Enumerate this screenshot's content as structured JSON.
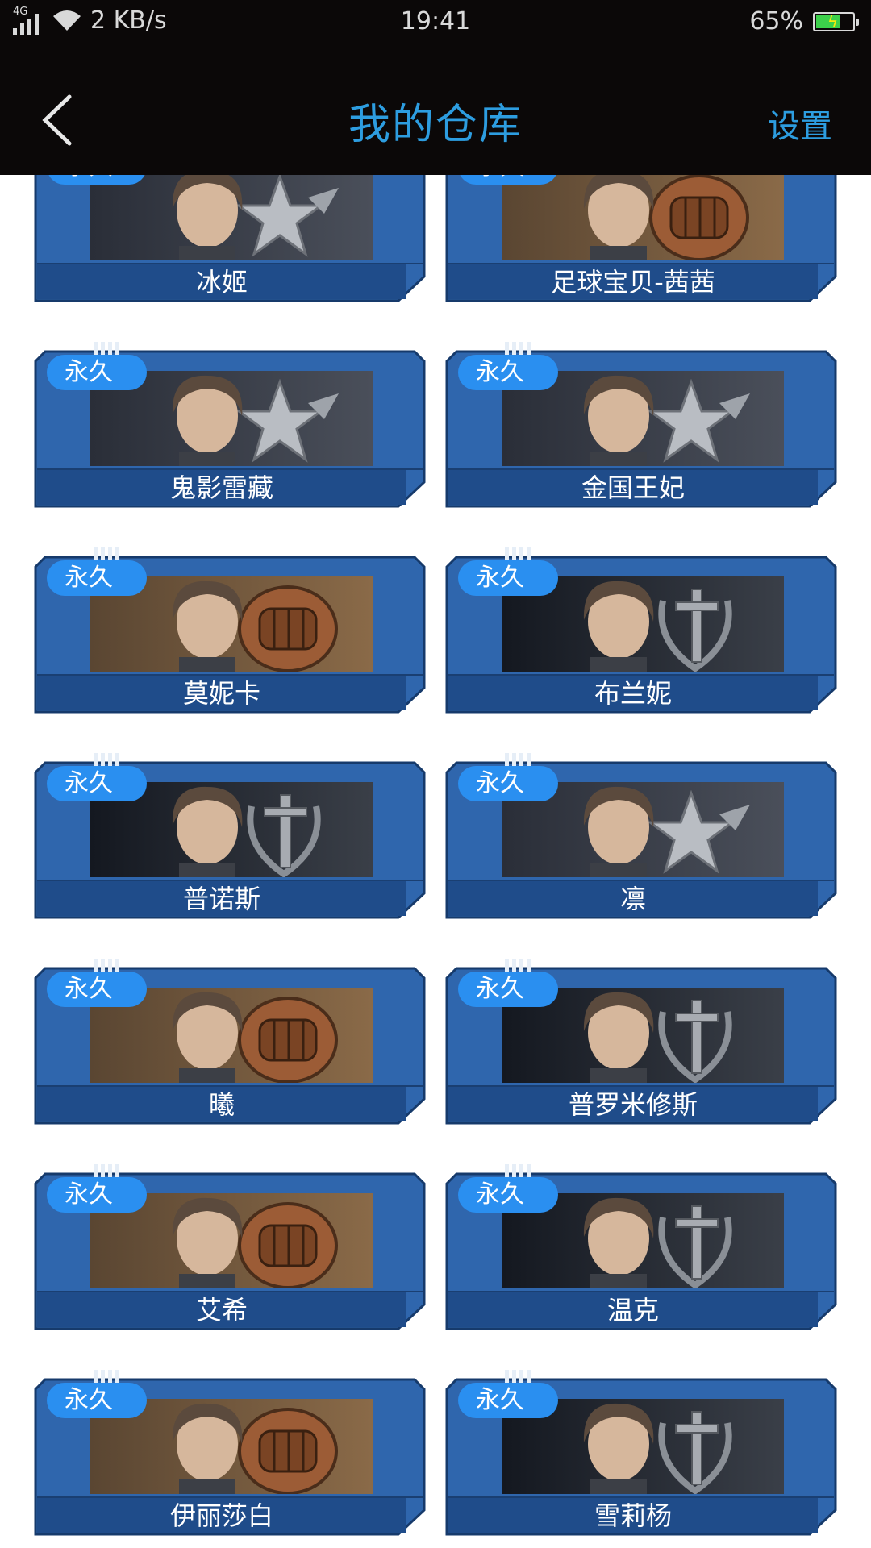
{
  "status_bar": {
    "network_type": "4G",
    "speed": "2 KB/s",
    "time": "19:41",
    "battery": "65%",
    "battery_level": 0.65
  },
  "nav": {
    "back_icon": "chevron-left-icon",
    "title": "我的仓库",
    "settings_label": "设置"
  },
  "items": [
    {
      "name": "冰姬",
      "badge": "永久",
      "emblem": "star"
    },
    {
      "name": "足球宝贝-茜茜",
      "badge": "永久",
      "emblem": "fist"
    },
    {
      "name": "鬼影雷藏",
      "badge": "永久",
      "emblem": "star"
    },
    {
      "name": "金国王妃",
      "badge": "永久",
      "emblem": "star"
    },
    {
      "name": "莫妮卡",
      "badge": "永久",
      "emblem": "fist"
    },
    {
      "name": "布兰妮",
      "badge": "永久",
      "emblem": "sword"
    },
    {
      "name": "普诺斯",
      "badge": "永久",
      "emblem": "sword"
    },
    {
      "name": "凛",
      "badge": "永久",
      "emblem": "star"
    },
    {
      "name": "曦",
      "badge": "永久",
      "emblem": "fist"
    },
    {
      "name": "普罗米修斯",
      "badge": "永久",
      "emblem": "sword"
    },
    {
      "name": "艾希",
      "badge": "永久",
      "emblem": "fist"
    },
    {
      "name": "温克",
      "badge": "永久",
      "emblem": "sword"
    },
    {
      "name": "伊丽莎白",
      "badge": "永久",
      "emblem": "fist"
    },
    {
      "name": "雪莉杨",
      "badge": "永久",
      "emblem": "sword"
    }
  ],
  "colors": {
    "accent": "#2d9de0",
    "card_blue": "#2f66ad",
    "card_dark": "#1f4c8a",
    "badge": "#2a8ff0"
  }
}
